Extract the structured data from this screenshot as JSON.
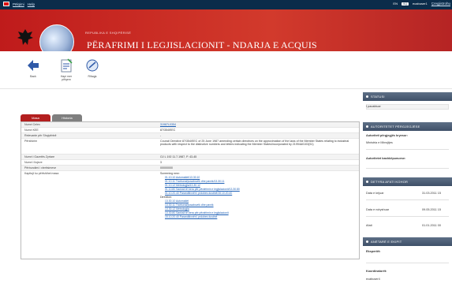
{
  "topbar": {
    "link1": "Pëlqimi",
    "link2": "Help",
    "lang": "EN",
    "lang_pill": "SQ",
    "user": "ecabuser1",
    "logout": "Çregjistrohu"
  },
  "header": {
    "ministry": "REPUBLIKA E SHQIPËRISË",
    "title": "PËRAFRIMI I LEGJISLACIONIT - NDARJA E ACQUIS",
    "ministry_tag": "MINISTRIA E INTEGRIMIT"
  },
  "toolbar": {
    "back": "Back",
    "new_opinion_1": "Hapi mer",
    "new_opinion_2": "pëlqem",
    "edit": "Rifaqja"
  },
  "tabs": {
    "main": "Masa",
    "history": "Historia"
  },
  "detail": {
    "rows": [
      {
        "key": "Numri Celex",
        "value": "31987L0354",
        "link": true
      },
      {
        "key": "Numri KEE",
        "value": "87/354/EEC",
        "link": false
      },
      {
        "key": "Relevante për Shqipërinë",
        "value": "-",
        "link": false
      },
      {
        "key": "Përshkrim",
        "value": "Council Directive 87/354/EEC of 25 June 1987 amending certain directives on the approximation of the laws of the Member States relating to industrial products with respect to the distinctive numbers and letters indicating the Member States/incorporated by 21994A0103(51)",
        "link": false
      },
      {
        "key": "Numri i Gazetës Zyrtare",
        "value": "OJ L 192 11.7.1987, P. 43-45",
        "link": false
      },
      {
        "key": "Numri i llojeve",
        "value": "3",
        "link": false
      },
      {
        "key": "Përbundimi i vlerësimeve",
        "value": "00000000",
        "link": false
      }
    ],
    "screening": {
      "key": "Kapitujt ku përfshihet masa",
      "heading": "Screening new:",
      "items": [
        "01.10.10 Automatiet/13.30.10",
        "01.10.11 Trarburat/pusabovrik dhe pavrik/13.30.11",
        "01.10.12 Metrologjia/13.30.12",
        "01.10.80 Sanksit të bera për përafrimin e legjislacionit/13.30.80",
        "01.10.20.40 Paranditivnëri i prdobes dustinë/15.10.20.40"
      ],
      "heading2": "Direction:",
      "items2": [
        "13.30.10 Automatiet",
        "13.30.11 Trarburat/pusabovrik dhe pavrik",
        "13.30.12 Metrologjia",
        "13.30.80 Sanksit të bera për përafrimin e legjislacionit",
        "15.10.20.40 Paranditivnëri i prdobes dustinë"
      ]
    }
  },
  "sidebar": {
    "status_head": "STATUSI",
    "status_val": "I pacaktuar",
    "auth_head": "AUTORITETET PËRGJEGJËSE",
    "lead_label": "Autoriteti përgjegjës kryesor:",
    "lead_val": "Ministria e Mbrojtjes",
    "co_label": "Autoritetet bashkëpunuese:",
    "deadline_head": "DETYRA AFATI KOHOR",
    "d1_label": "Data e krijuar",
    "d1_val": "31.03.2011 15",
    "d2_label": "Data e ndryshuar",
    "d2_val": "09.05.2011 15",
    "d3_label": "Afati",
    "d3_val": "01.01.2011 00",
    "experts_head": "ANËTARË E EKIPIT",
    "expert_label": "Ekspertët:",
    "coord_label": "Koordinatorët:",
    "coord_val": "ecabuser4"
  }
}
